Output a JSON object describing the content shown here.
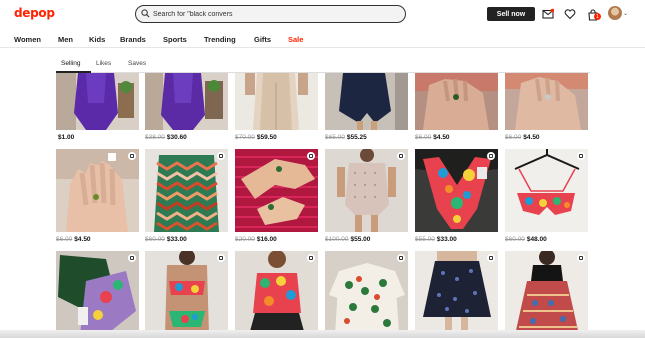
{
  "header": {
    "logo": "depop",
    "search_value": "Search for \"black convers",
    "sell_label": "Sell now",
    "icons": [
      "search-icon",
      "messages-icon",
      "heart-icon",
      "bag-icon",
      "chevron-down-icon"
    ],
    "bag_count": "1",
    "brand_color": "#ff2300"
  },
  "nav": [
    {
      "label": "Women"
    },
    {
      "label": "Men"
    },
    {
      "label": "Kids"
    },
    {
      "label": "Brands"
    },
    {
      "label": "Sports"
    },
    {
      "label": "Trending"
    },
    {
      "label": "Gifts"
    },
    {
      "label": "Sale"
    }
  ],
  "profile_tabs": [
    {
      "label": "Selling",
      "active": true
    },
    {
      "label": "Likes",
      "active": false
    },
    {
      "label": "Saves",
      "active": false
    }
  ],
  "rows": [
    [
      {
        "old": "",
        "price": "$1.00"
      },
      {
        "old": "$38.00",
        "price": "$30.60"
      },
      {
        "old": "$70.00",
        "price": "$59.50"
      },
      {
        "old": "$65.00",
        "price": "$55.25"
      },
      {
        "old": "$6.00",
        "price": "$4.50"
      },
      {
        "old": "$6.00",
        "price": "$4.50"
      }
    ],
    [
      {
        "old": "$6.00",
        "price": "$4.50"
      },
      {
        "old": "$60.00",
        "price": "$33.00"
      },
      {
        "old": "$20.00",
        "price": "$16.00"
      },
      {
        "old": "$100.00",
        "price": "$55.00"
      },
      {
        "old": "$55.00",
        "price": "$33.00"
      },
      {
        "old": "$60.00",
        "price": "$48.00"
      }
    ],
    [
      {
        "old": "",
        "price": ""
      },
      {
        "old": "",
        "price": ""
      },
      {
        "old": "",
        "price": ""
      },
      {
        "old": "",
        "price": ""
      },
      {
        "old": "",
        "price": ""
      },
      {
        "old": "",
        "price": ""
      }
    ]
  ]
}
